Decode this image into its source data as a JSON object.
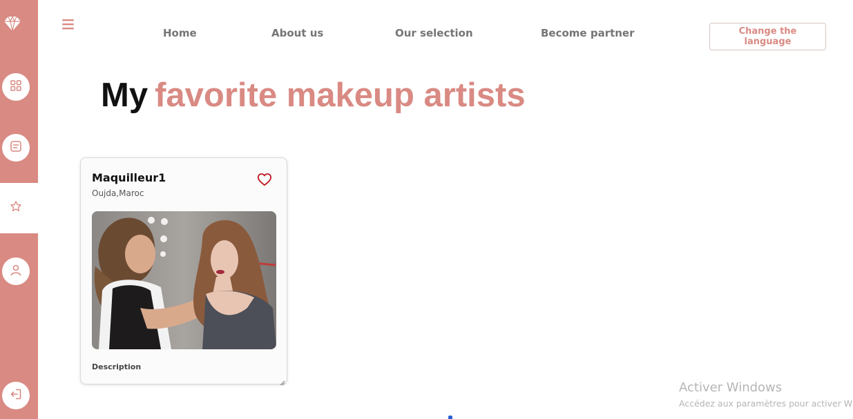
{
  "sidebar": {
    "logo_icon": "diamond-icon",
    "items": [
      {
        "icon": "grid-icon",
        "active": false
      },
      {
        "icon": "message-icon",
        "active": false
      },
      {
        "icon": "star-icon",
        "active": true
      },
      {
        "icon": "user-icon",
        "active": false
      },
      {
        "icon": "logout-icon",
        "active": false
      }
    ]
  },
  "header": {
    "menu_icon": "hamburger-icon",
    "nav": {
      "home": "Home",
      "about": "About us",
      "selection": "Our selection",
      "partner": "Become partner"
    },
    "language_button": "Change the language"
  },
  "page": {
    "title_part1": "My",
    "title_part2": "favorite makeup artists"
  },
  "cards": [
    {
      "name": "Maquilleur1",
      "location": "Oujda,Maroc",
      "favorite": true,
      "favorite_icon": "heart-icon",
      "description_label": "Description"
    }
  ],
  "watermark": {
    "title": "Activer Windows",
    "subtitle": "Accédez aux paramètres pour activer Windows."
  },
  "colors": {
    "accent": "#d98a83",
    "heart": "#c0151f",
    "nav_text": "#757575"
  }
}
